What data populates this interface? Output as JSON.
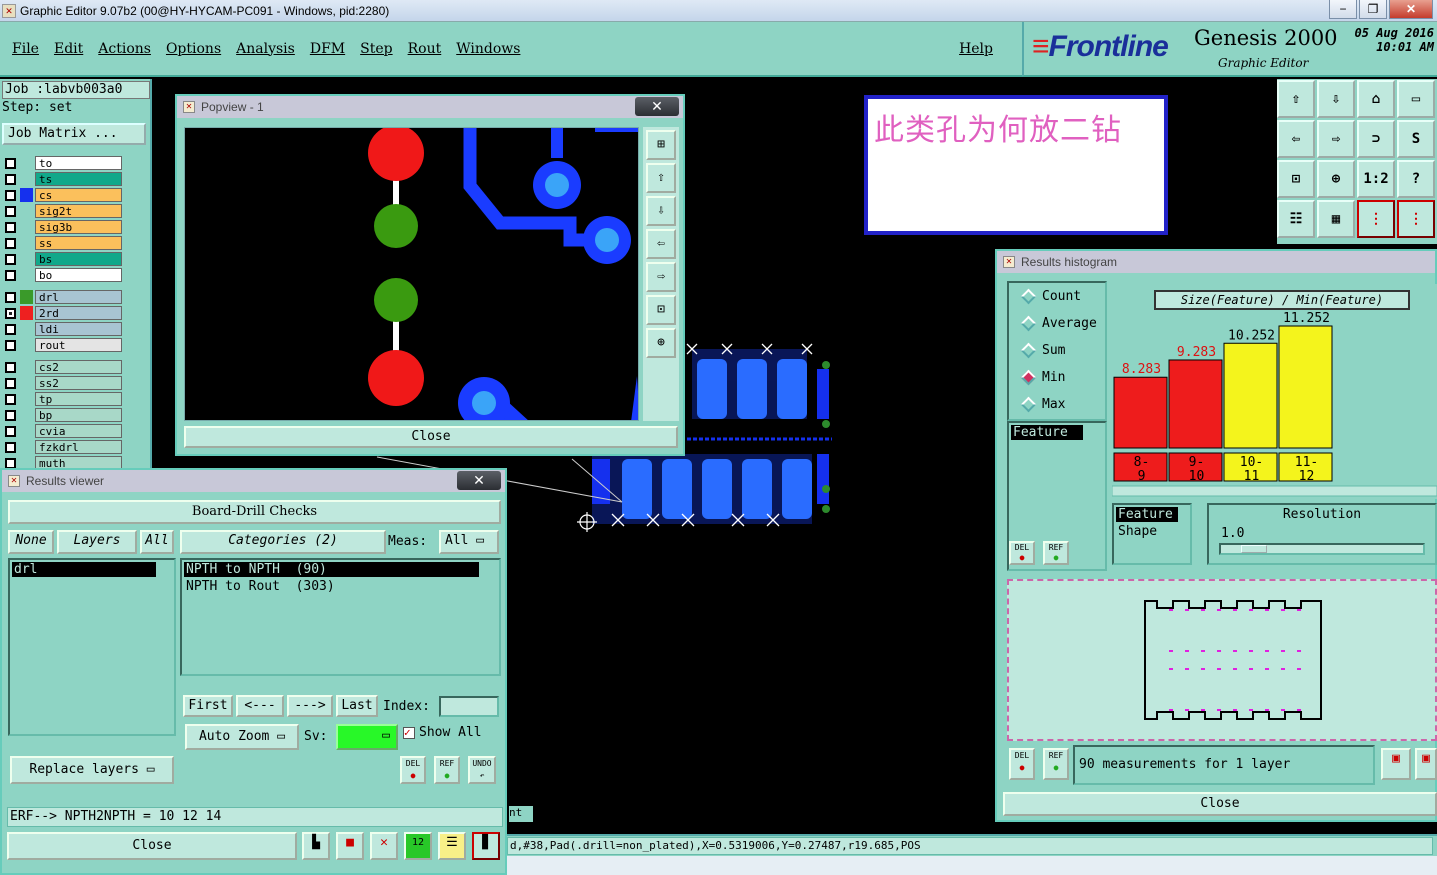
{
  "window": {
    "title": "Graphic Editor 9.07b2 (00@HY-HYCAM-PC091 - Windows, pid:2280)"
  },
  "menu": {
    "items": [
      "File",
      "Edit",
      "Actions",
      "Options",
      "Analysis",
      "DFM",
      "Step",
      "Rout",
      "Windows"
    ],
    "help": "Help"
  },
  "brand": {
    "logo": "Frontline",
    "product": "Genesis 2000",
    "subtitle": "Graphic Editor",
    "date": "05 Aug 2016",
    "time": "10:01 AM"
  },
  "job": {
    "label": "Job :",
    "name": "labvb003a0",
    "step_label": "Step:",
    "step": "set",
    "matrix_button": "Job Matrix ..."
  },
  "layers": [
    {
      "name": "to",
      "color": "#ffffff",
      "swatch": "#8ed4c4",
      "checked": false
    },
    {
      "name": "ts",
      "color": "#11a88a",
      "swatch": "#8ed4c4",
      "checked": false
    },
    {
      "name": "cs",
      "color": "#fbc05c",
      "swatch": "#1530ee",
      "checked": false
    },
    {
      "name": "sig2t",
      "color": "#fbc05c",
      "swatch": "#8ed4c4",
      "checked": false
    },
    {
      "name": "sig3b",
      "color": "#fbc05c",
      "swatch": "#8ed4c4",
      "checked": false
    },
    {
      "name": "ss",
      "color": "#fbc05c",
      "swatch": "#8ed4c4",
      "checked": false
    },
    {
      "name": "bs",
      "color": "#11a88a",
      "swatch": "#8ed4c4",
      "checked": false
    },
    {
      "name": "bo",
      "color": "#ffffff",
      "swatch": "#8ed4c4",
      "checked": false
    },
    {
      "gap": true
    },
    {
      "name": "drl",
      "color": "#a8c4d2",
      "swatch": "#3a9a2a",
      "checked": false
    },
    {
      "name": "2rd",
      "color": "#a8c4d2",
      "swatch": "#ee2020",
      "checked": true
    },
    {
      "name": "ldi",
      "color": "#a8c4d2",
      "swatch": "#8ed4c4",
      "checked": false
    },
    {
      "name": "rout",
      "color": "#e4e4e4",
      "swatch": "#8ed4c4",
      "checked": false
    },
    {
      "gap": true
    },
    {
      "name": "cs2",
      "color": "#a8d8c8",
      "swatch": "#8ed4c4",
      "checked": false
    },
    {
      "name": "ss2",
      "color": "#a8d8c8",
      "swatch": "#8ed4c4",
      "checked": false
    },
    {
      "name": "tp",
      "color": "#a8d8c8",
      "swatch": "#8ed4c4",
      "checked": false
    },
    {
      "name": "bp",
      "color": "#a8d8c8",
      "swatch": "#8ed4c4",
      "checked": false
    },
    {
      "name": "cvia",
      "color": "#a8d8c8",
      "swatch": "#8ed4c4",
      "checked": false
    },
    {
      "name": "fzkdrl",
      "color": "#a8d8c8",
      "swatch": "#8ed4c4",
      "checked": false
    },
    {
      "name": "muth",
      "color": "#a8d8c8",
      "swatch": "#8ed4c4",
      "checked": false
    }
  ],
  "note": {
    "text": "此类孔为何放二钻"
  },
  "popview": {
    "title": "Popview - 1",
    "close": "Close"
  },
  "results_viewer": {
    "title": "Results viewer",
    "header": "Board-Drill Checks",
    "none": "None",
    "layers": "Layers",
    "all": "All",
    "categories": "Categories (2)",
    "meas_label": "Meas:",
    "meas_value": "All",
    "layer_items": [
      "drl"
    ],
    "category_items": [
      "NPTH to NPTH  (90)",
      "NPTH to Rout  (303)"
    ],
    "first": "First",
    "prev": "<---",
    "next": "--->",
    "last": "Last",
    "index_label": "Index:",
    "auto_zoom": "Auto Zoom",
    "sv_label": "Sv:",
    "show_all": "Show All",
    "replace_layers": "Replace layers",
    "del": "DEL",
    "ref": "REF",
    "undo": "UNDO",
    "erf": "ERF--> NPTH2NPTH = 10 12 14",
    "close": "Close"
  },
  "histogram": {
    "title": "Results histogram",
    "options": [
      "Count",
      "Average",
      "Sum",
      "Min",
      "Max"
    ],
    "selected": "Min",
    "header": "Size(Feature) / Min(Feature)",
    "feature_list": [
      "Feature"
    ],
    "shape_list": [
      "Feature",
      "Shape"
    ],
    "resolution_label": "Resolution",
    "resolution_value": "1.0",
    "measurements": "90 measurements for 1 layer",
    "close": "Close",
    "del": "DEL",
    "ref": "REF"
  },
  "chart_data": {
    "type": "bar",
    "categories": [
      "8-9",
      "9-10",
      "10-11",
      "11-12"
    ],
    "tick_labels": [
      [
        "8-",
        "9"
      ],
      [
        "9-",
        "10"
      ],
      [
        "10-",
        "11"
      ],
      [
        "11-",
        "12"
      ]
    ],
    "values": [
      8.283,
      9.283,
      10.252,
      11.252
    ],
    "value_labels": [
      "8.283",
      "9.283",
      "10.252",
      "11.252"
    ],
    "bar_colors": [
      "#ee1c1c",
      "#ee1c1c",
      "#f4f41c",
      "#f4f41c"
    ],
    "label_colors": [
      "#dd1111",
      "#dd1111",
      "#000000",
      "#000000"
    ],
    "title": "Size(Feature) / Min(Feature)",
    "ylim": [
      0,
      12
    ],
    "grid": false
  },
  "status": {
    "text": "d,#38,Pad(.drill=non_plated),X=0.5319006,Y=0.27487,r19.685,POS",
    "partial": "nt"
  }
}
